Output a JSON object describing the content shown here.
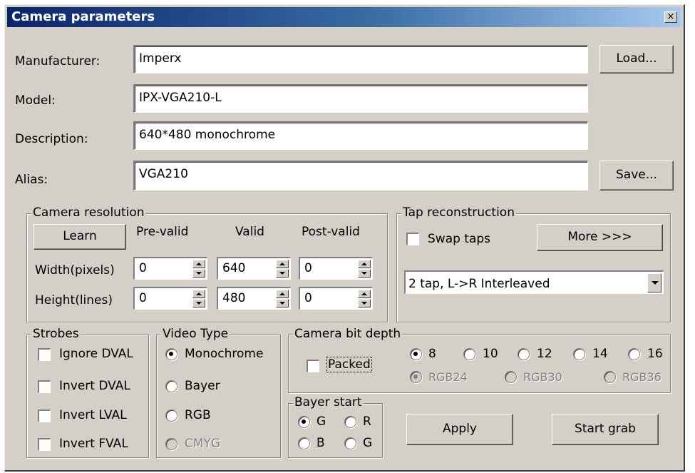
{
  "window": {
    "title": "Camera parameters",
    "close_glyph": "×"
  },
  "fields": {
    "manufacturer": {
      "label": "Manufacturer:",
      "value": "Imperx"
    },
    "model": {
      "label": "Model:",
      "value": "IPX-VGA210-L"
    },
    "description": {
      "label": "Description:",
      "value": "640*480 monochrome"
    },
    "alias": {
      "label": "Alias:",
      "value": "VGA210"
    }
  },
  "buttons": {
    "load": "Load...",
    "save": "Save...",
    "apply": "Apply",
    "start_grab": "Start grab"
  },
  "resolution": {
    "title": "Camera resolution",
    "learn": "Learn",
    "col_pre": "Pre-valid",
    "col_valid": "Valid",
    "col_post": "Post-valid",
    "width_label": "Width(pixels)",
    "height_label": "Height(lines)",
    "width": {
      "pre": "0",
      "valid": "640",
      "post": "0"
    },
    "height": {
      "pre": "0",
      "valid": "480",
      "post": "0"
    }
  },
  "tap": {
    "title": "Tap reconstruction",
    "swap_label": "Swap taps",
    "swap_checked": false,
    "more": "More >>>",
    "mode": "2 tap, L->R Interleaved"
  },
  "strobes": {
    "title": "Strobes",
    "items": [
      "Ignore DVAL",
      "Invert DVAL",
      "Invert LVAL",
      "Invert FVAL"
    ]
  },
  "video_type": {
    "title": "Video Type",
    "options": [
      "Monochrome",
      "Bayer",
      "RGB",
      "CMYG"
    ],
    "selected": "Monochrome",
    "disabled": [
      "CMYG"
    ]
  },
  "bit_depth": {
    "title": "Camera bit depth",
    "packed": "Packed",
    "mono_options": [
      "8",
      "10",
      "12",
      "14",
      "16"
    ],
    "selected": "8",
    "rgb_options": [
      "RGB24",
      "RGB30",
      "RGB36"
    ]
  },
  "bayer_start": {
    "title": "Bayer start",
    "options": [
      "G",
      "R",
      "B",
      "G"
    ],
    "selected_index": 0
  }
}
